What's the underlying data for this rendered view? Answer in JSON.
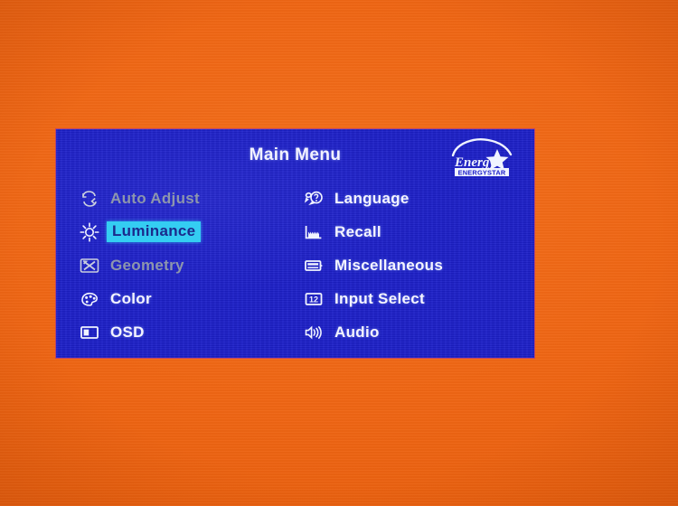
{
  "colors": {
    "screen_background": "#ef6614",
    "osd_panel": "#1b1ec9",
    "osd_text": "#f4f4ff",
    "osd_text_disabled": "#8d96ad",
    "highlight_background": "#34cdf2",
    "highlight_text": "#1b2a8c"
  },
  "osd": {
    "title": "Main Menu",
    "logo": {
      "script_text": "Energy",
      "wordmark": "ENERGY STAR",
      "name": "energy-star-logo"
    },
    "left_column": [
      {
        "label": "Auto Adjust",
        "icon": "auto-adjust-icon",
        "state": "disabled"
      },
      {
        "label": "Luminance",
        "icon": "luminance-icon",
        "state": "selected"
      },
      {
        "label": "Geometry",
        "icon": "geometry-icon",
        "state": "disabled"
      },
      {
        "label": "Color",
        "icon": "color-palette-icon",
        "state": "normal"
      },
      {
        "label": "OSD",
        "icon": "osd-icon",
        "state": "normal"
      }
    ],
    "right_column": [
      {
        "label": "Language",
        "icon": "language-icon",
        "state": "normal"
      },
      {
        "label": "Recall",
        "icon": "recall-icon",
        "state": "normal"
      },
      {
        "label": "Miscellaneous",
        "icon": "miscellaneous-icon",
        "state": "normal"
      },
      {
        "label": "Input Select",
        "icon": "input-select-icon",
        "state": "normal"
      },
      {
        "label": "Audio",
        "icon": "audio-icon",
        "state": "normal"
      }
    ]
  }
}
